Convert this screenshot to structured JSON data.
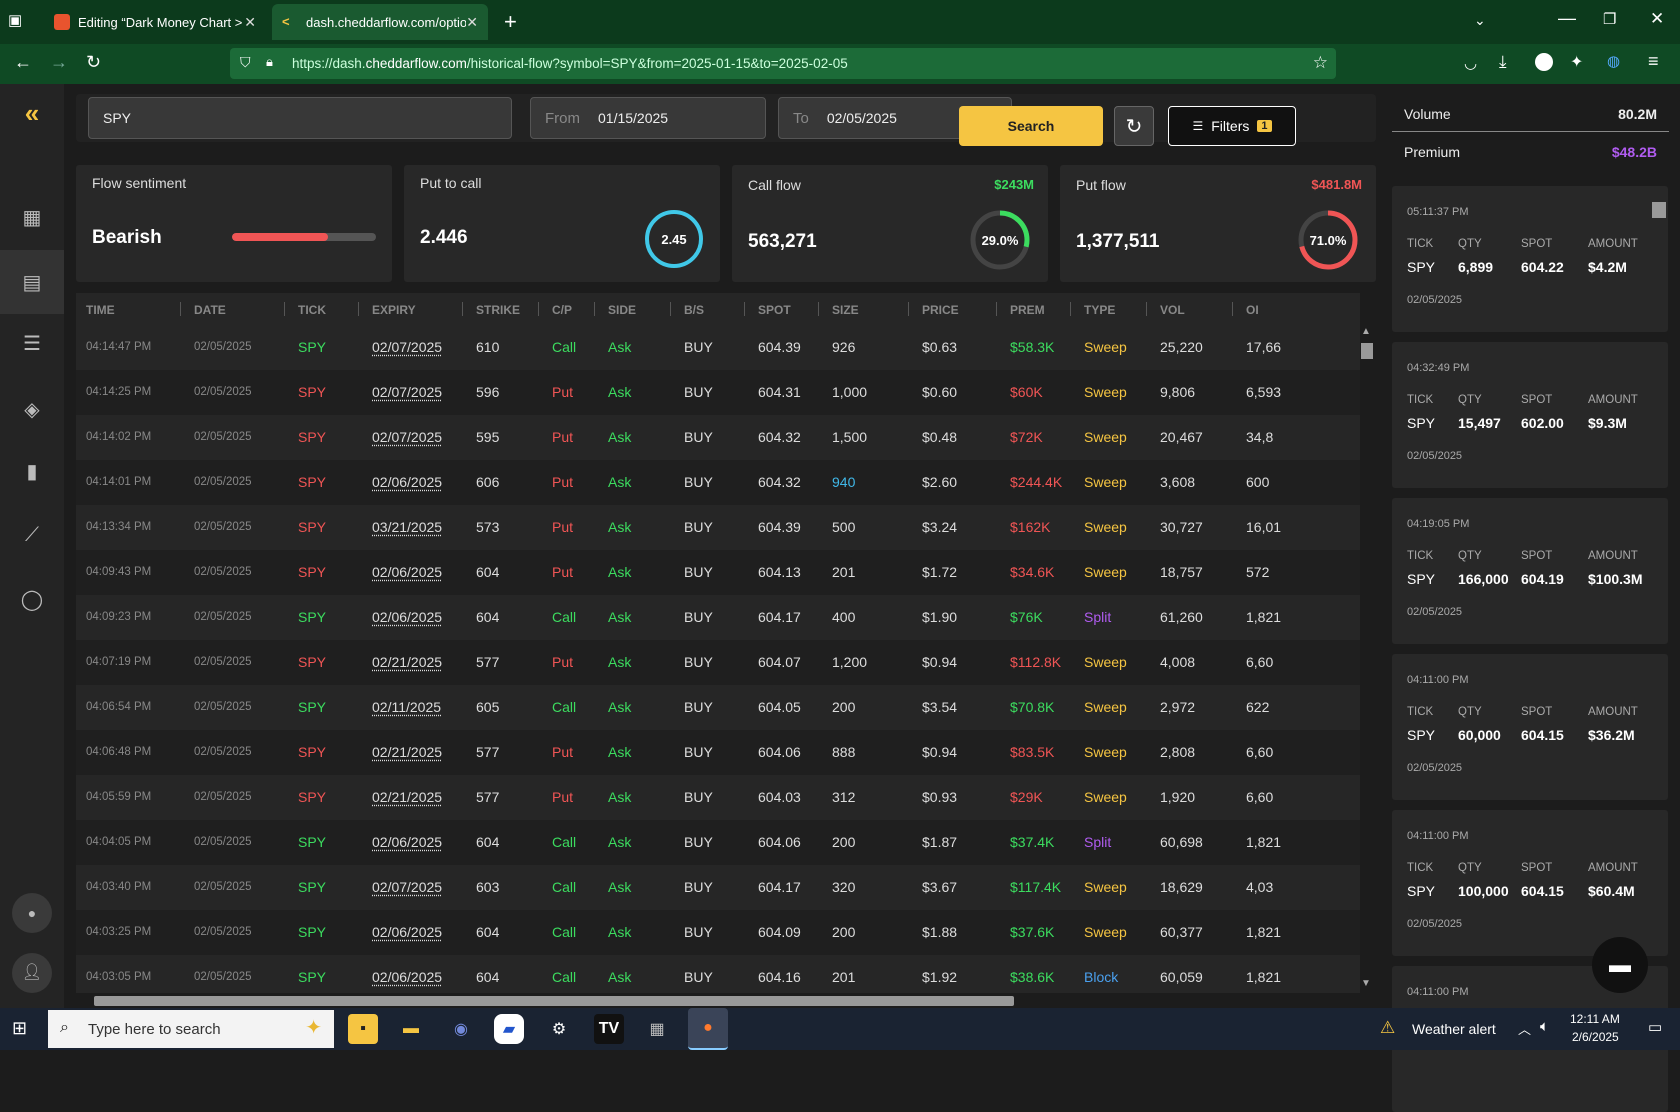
{
  "browser": {
    "tabs": [
      {
        "title": "Editing “Dark Money Chart > Th",
        "close": "✕"
      },
      {
        "title": "dash.cheddarflow.com/options-",
        "close": "✕"
      }
    ],
    "new_tab": "+",
    "url_domain": "dash.",
    "url_domain_bold": "cheddarflow.com",
    "url_path": "/historical-flow?symbol=SPY&from=2025-01-15&to=2025-02-05",
    "url_scheme": "https://"
  },
  "search": {
    "symbol": "SPY",
    "from_label": "From",
    "from_value": "01/15/2025",
    "to_label": "To",
    "to_value": "02/05/2025",
    "search_label": "Search",
    "filters_label": "Filters",
    "filters_count": "1"
  },
  "cards": {
    "sentiment": {
      "title": "Flow sentiment",
      "value": "Bearish",
      "bar_fill_pct": 67
    },
    "put_call": {
      "title": "Put to call",
      "value": "2.446",
      "ring_value": "2.45"
    },
    "call_flow": {
      "title": "Call flow",
      "amount": "$243M",
      "value": "563,271",
      "ring_value": "29.0%",
      "ring_pct": 29.0
    },
    "put_flow": {
      "title": "Put flow",
      "amount": "$481.8M",
      "value": "1,377,511",
      "ring_value": "71.0%",
      "ring_pct": 71.0
    }
  },
  "table": {
    "headers": [
      "TIME",
      "DATE",
      "TICK",
      "EXPIRY",
      "STRIKE",
      "C/P",
      "SIDE",
      "B/S",
      "SPOT",
      "SIZE",
      "PRICE",
      "PREM",
      "TYPE",
      "VOL",
      "OI"
    ],
    "rows": [
      [
        "04:14:47 PM",
        "02/05/2025",
        "SPY",
        "02/07/2025",
        "610",
        "Call",
        "Ask",
        "BUY",
        "604.39",
        "926",
        "$0.63",
        "$58.3K",
        "Sweep",
        "25,220",
        "17,66"
      ],
      [
        "04:14:25 PM",
        "02/05/2025",
        "SPY",
        "02/07/2025",
        "596",
        "Put",
        "Ask",
        "BUY",
        "604.31",
        "1,000",
        "$0.60",
        "$60K",
        "Sweep",
        "9,806",
        "6,593"
      ],
      [
        "04:14:02 PM",
        "02/05/2025",
        "SPY",
        "02/07/2025",
        "595",
        "Put",
        "Ask",
        "BUY",
        "604.32",
        "1,500",
        "$0.48",
        "$72K",
        "Sweep",
        "20,467",
        "34,8"
      ],
      [
        "04:14:01 PM",
        "02/05/2025",
        "SPY",
        "02/06/2025",
        "606",
        "Put",
        "Ask",
        "BUY",
        "604.32",
        "940",
        "$2.60",
        "$244.4K",
        "Sweep",
        "3,608",
        "600"
      ],
      [
        "04:13:34 PM",
        "02/05/2025",
        "SPY",
        "03/21/2025",
        "573",
        "Put",
        "Ask",
        "BUY",
        "604.39",
        "500",
        "$3.24",
        "$162K",
        "Sweep",
        "30,727",
        "16,01"
      ],
      [
        "04:09:43 PM",
        "02/05/2025",
        "SPY",
        "02/06/2025",
        "604",
        "Put",
        "Ask",
        "BUY",
        "604.13",
        "201",
        "$1.72",
        "$34.6K",
        "Sweep",
        "18,757",
        "572"
      ],
      [
        "04:09:23 PM",
        "02/05/2025",
        "SPY",
        "02/06/2025",
        "604",
        "Call",
        "Ask",
        "BUY",
        "604.17",
        "400",
        "$1.90",
        "$76K",
        "Split",
        "61,260",
        "1,821"
      ],
      [
        "04:07:19 PM",
        "02/05/2025",
        "SPY",
        "02/21/2025",
        "577",
        "Put",
        "Ask",
        "BUY",
        "604.07",
        "1,200",
        "$0.94",
        "$112.8K",
        "Sweep",
        "4,008",
        "6,60"
      ],
      [
        "04:06:54 PM",
        "02/05/2025",
        "SPY",
        "02/11/2025",
        "605",
        "Call",
        "Ask",
        "BUY",
        "604.05",
        "200",
        "$3.54",
        "$70.8K",
        "Sweep",
        "2,972",
        "622"
      ],
      [
        "04:06:48 PM",
        "02/05/2025",
        "SPY",
        "02/21/2025",
        "577",
        "Put",
        "Ask",
        "BUY",
        "604.06",
        "888",
        "$0.94",
        "$83.5K",
        "Sweep",
        "2,808",
        "6,60"
      ],
      [
        "04:05:59 PM",
        "02/05/2025",
        "SPY",
        "02/21/2025",
        "577",
        "Put",
        "Ask",
        "BUY",
        "604.03",
        "312",
        "$0.93",
        "$29K",
        "Sweep",
        "1,920",
        "6,60"
      ],
      [
        "04:04:05 PM",
        "02/05/2025",
        "SPY",
        "02/06/2025",
        "604",
        "Call",
        "Ask",
        "BUY",
        "604.06",
        "200",
        "$1.87",
        "$37.4K",
        "Split",
        "60,698",
        "1,821"
      ],
      [
        "04:03:40 PM",
        "02/05/2025",
        "SPY",
        "02/07/2025",
        "603",
        "Call",
        "Ask",
        "BUY",
        "604.17",
        "320",
        "$3.67",
        "$117.4K",
        "Sweep",
        "18,629",
        "4,03"
      ],
      [
        "04:03:25 PM",
        "02/05/2025",
        "SPY",
        "02/06/2025",
        "604",
        "Call",
        "Ask",
        "BUY",
        "604.09",
        "200",
        "$1.88",
        "$37.6K",
        "Sweep",
        "60,377",
        "1,821"
      ],
      [
        "04:03:05 PM",
        "02/05/2025",
        "SPY",
        "02/06/2025",
        "604",
        "Call",
        "Ask",
        "BUY",
        "604.16",
        "201",
        "$1.92",
        "$38.6K",
        "Block",
        "60,059",
        "1,821"
      ]
    ]
  },
  "right_panel": {
    "volume_label": "Volume",
    "volume_value": "80.2M",
    "premium_label": "Premium",
    "premium_value": "$48.2B",
    "trades": [
      {
        "time": "05:11:37 PM",
        "tick": "SPY",
        "qty": "6,899",
        "spot": "604.22",
        "amount": "$4.2M",
        "date": "02/05/2025"
      },
      {
        "time": "04:32:49 PM",
        "tick": "SPY",
        "qty": "15,497",
        "spot": "602.00",
        "amount": "$9.3M",
        "date": "02/05/2025"
      },
      {
        "time": "04:19:05 PM",
        "tick": "SPY",
        "qty": "166,000",
        "spot": "604.19",
        "amount": "$100.3M",
        "date": "02/05/2025"
      },
      {
        "time": "04:11:00 PM",
        "tick": "SPY",
        "qty": "60,000",
        "spot": "604.15",
        "amount": "$36.2M",
        "date": "02/05/2025"
      },
      {
        "time": "04:11:00 PM",
        "tick": "SPY",
        "qty": "100,000",
        "spot": "604.15",
        "amount": "$60.4M",
        "date": "02/05/2025"
      },
      {
        "time": "04:11:00 PM"
      }
    ],
    "labels": {
      "tick": "TICK",
      "qty": "QTY",
      "spot": "SPOT",
      "amount": "AMOUNT"
    }
  },
  "taskbar": {
    "search_placeholder": "Type here to search",
    "weather": "Weather alert",
    "time": "12:11 AM",
    "date": "2/6/2025"
  },
  "colors": {
    "accent": "#f5c542",
    "call": "#3cdc5f",
    "put": "#f05555",
    "premium": "#b05cf0"
  }
}
